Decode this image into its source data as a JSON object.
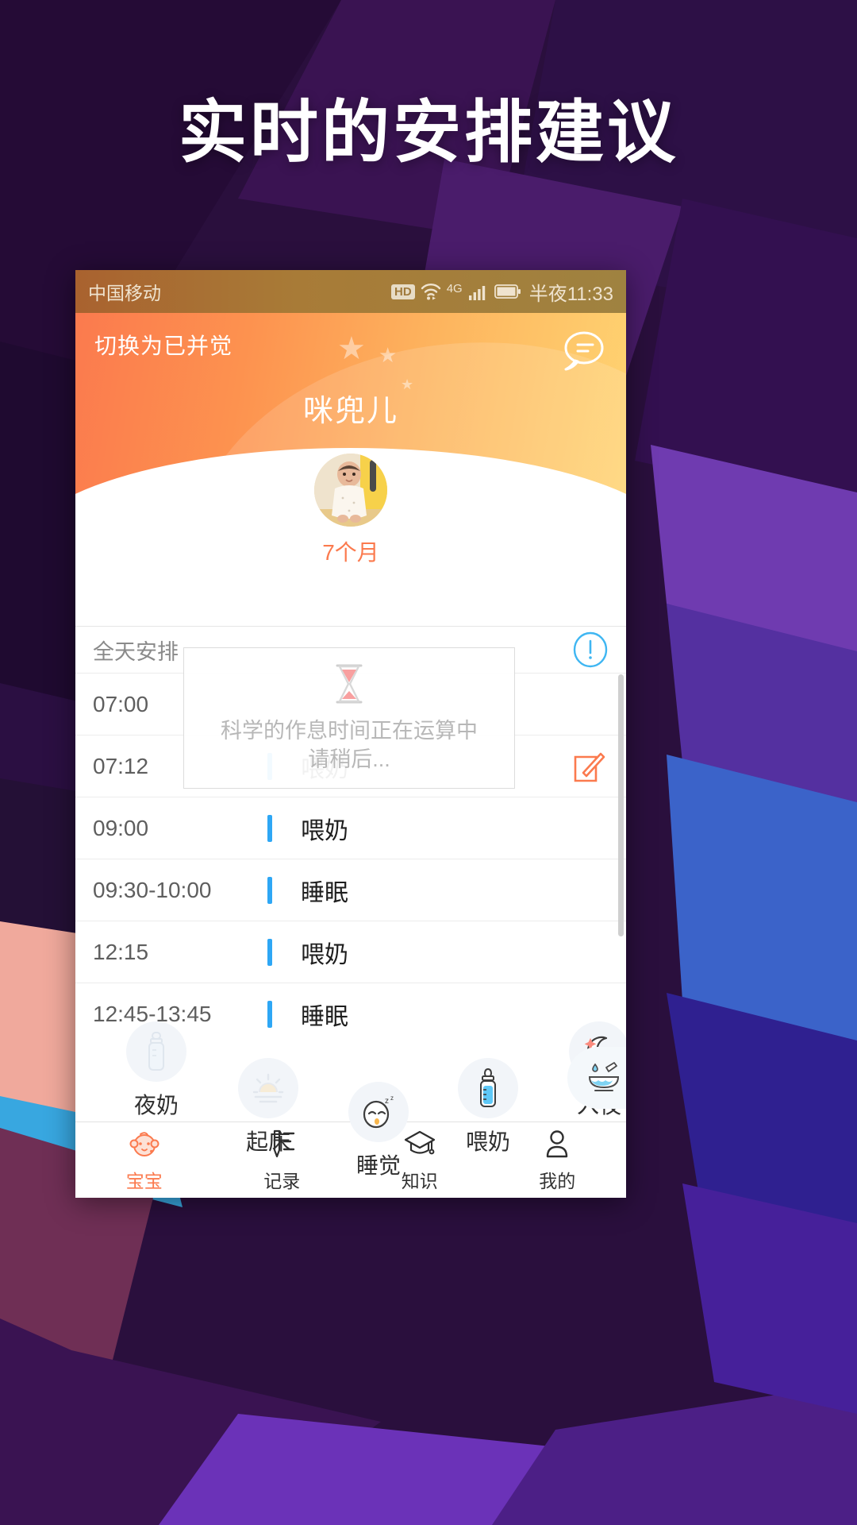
{
  "promo": {
    "headline": "实时的安排建议"
  },
  "statusbar": {
    "carrier": "中国移动",
    "hd": "HD",
    "network": "4G",
    "time": "半夜11:33",
    "icons": [
      "hd-badge",
      "wifi-icon",
      "signal-icon",
      "battery-icon"
    ]
  },
  "header": {
    "switch_label": "切换为已并觉",
    "chat_icon": "chat-bubble-icon",
    "baby_name": "咪兜儿",
    "age": "7个月",
    "avatar": "baby-avatar"
  },
  "actions": [
    {
      "label": "夜奶",
      "icon": "night-bottle-icon"
    },
    {
      "label": "起床",
      "icon": "sunrise-icon"
    },
    {
      "label": "睡觉",
      "icon": "sleeping-face-icon"
    },
    {
      "label": "喂奶",
      "icon": "milk-bottle-icon"
    },
    {
      "label": "入夜",
      "icon": "moon-icon"
    }
  ],
  "schedule": {
    "title": "全天安排",
    "info_icon": "exclamation-circle-icon",
    "rows": [
      {
        "time": "07:00",
        "label": "",
        "edit": false
      },
      {
        "time": "07:12",
        "label": "喂奶",
        "edit": true
      },
      {
        "time": "09:00",
        "label": "喂奶",
        "edit": false
      },
      {
        "time": "09:30-10:00",
        "label": "睡眠",
        "edit": false
      },
      {
        "time": "12:15",
        "label": "喂奶",
        "edit": false
      },
      {
        "time": "12:45-13:45",
        "label": "睡眠",
        "edit": false
      }
    ]
  },
  "overlay": {
    "icon": "hourglass-icon",
    "line1": "科学的作息时间正在运算中",
    "line2": "请稍后..."
  },
  "fab": {
    "icon": "food-bowl-icon"
  },
  "tabbar": [
    {
      "label": "宝宝",
      "icon": "baby-face-icon",
      "active": true
    },
    {
      "label": "记录",
      "icon": "pencil-list-icon",
      "active": false
    },
    {
      "label": "知识",
      "icon": "graduation-cap-icon",
      "active": false
    },
    {
      "label": "我的",
      "icon": "person-icon",
      "active": false
    }
  ],
  "colors": {
    "accent_orange": "#fb7a4e",
    "header_gradient_start": "#fb7a4e",
    "header_gradient_end": "#ffd472",
    "row_bar_blue": "#2ea7f5",
    "bg_purple": "#2a0f3d"
  }
}
